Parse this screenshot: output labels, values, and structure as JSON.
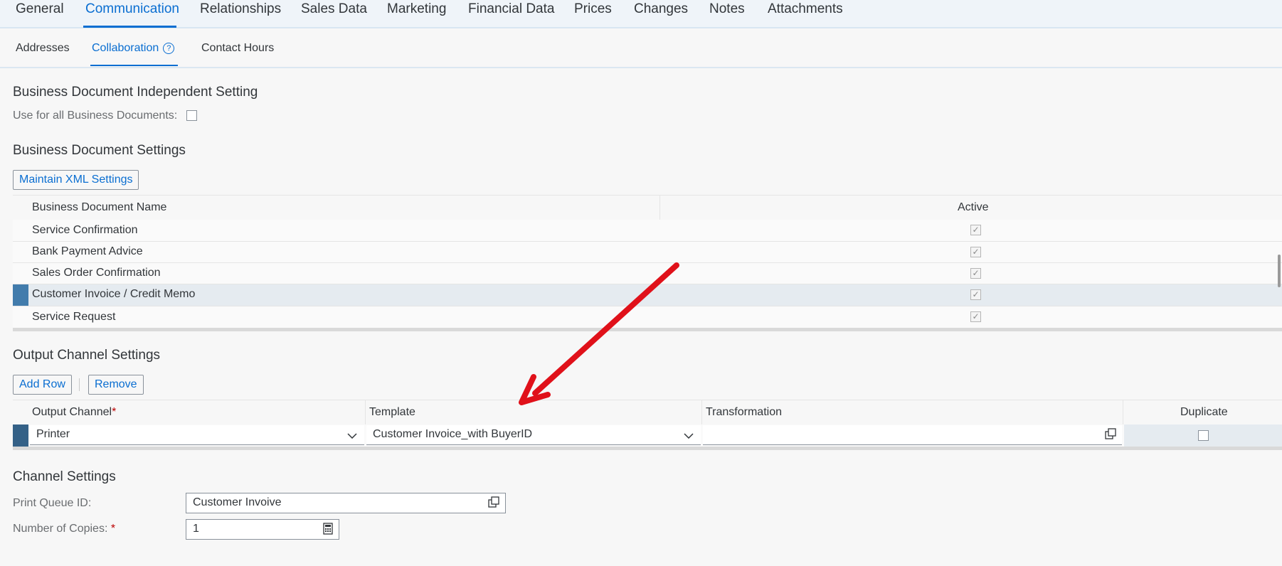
{
  "tabs": [
    "General",
    "Communication",
    "Relationships",
    "Sales Data",
    "Marketing",
    "Financial Data",
    "Prices",
    "Changes",
    "Notes",
    "Attachments"
  ],
  "subtabs": [
    "Addresses",
    "Collaboration",
    "Contact Hours"
  ],
  "independent": {
    "title": "Business Document Independent Setting",
    "use_all_label": "Use for all Business Documents:"
  },
  "doc_settings": {
    "title": "Business Document Settings",
    "maintain_button": "Maintain XML Settings",
    "col_name": "Business Document Name",
    "col_active": "Active",
    "rows": [
      {
        "name": "Service Confirmation",
        "active": true
      },
      {
        "name": "Bank Payment Advice",
        "active": true
      },
      {
        "name": "Sales Order Confirmation",
        "active": true
      },
      {
        "name": "Customer Invoice / Credit Memo",
        "active": true,
        "selected": true
      },
      {
        "name": "Service Request",
        "active": true
      }
    ]
  },
  "output": {
    "title": "Output Channel Settings",
    "add_row": "Add Row",
    "remove": "Remove",
    "col_channel": "Output Channel",
    "col_template": "Template",
    "col_transformation": "Transformation",
    "col_duplicate": "Duplicate",
    "row": {
      "channel": "Printer",
      "template": "Customer Invoice_with BuyerID",
      "transformation": "",
      "duplicate": false
    }
  },
  "channel_settings": {
    "title": "Channel Settings",
    "print_queue_label": "Print Queue ID:",
    "print_queue_value": "Customer Invoive",
    "copies_label": "Number of Copies:",
    "copies_value": "1"
  },
  "colors": {
    "accent": "#0a6ed1",
    "annotation_arrow": "#e0111a",
    "selection": "#427cac"
  }
}
